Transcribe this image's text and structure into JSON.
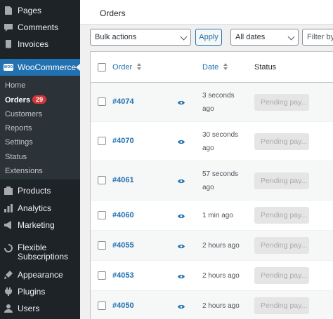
{
  "sidebar": {
    "items_top": [
      {
        "label": "Pages",
        "icon": "pages-icon"
      },
      {
        "label": "Comments",
        "icon": "comments-icon"
      },
      {
        "label": "Invoices",
        "icon": "invoices-icon"
      }
    ],
    "woocommerce": {
      "label": "WooCommerce",
      "icon": "woocommerce-icon"
    },
    "submenu": [
      {
        "label": "Home"
      },
      {
        "label": "Orders",
        "badge": "29"
      },
      {
        "label": "Customers"
      },
      {
        "label": "Reports"
      },
      {
        "label": "Settings"
      },
      {
        "label": "Status"
      },
      {
        "label": "Extensions"
      }
    ],
    "items_bottom": [
      {
        "label": "Products",
        "icon": "products-icon"
      },
      {
        "label": "Analytics",
        "icon": "analytics-icon"
      },
      {
        "label": "Marketing",
        "icon": "marketing-icon"
      },
      {
        "label_line1": "Flexible",
        "label_line2": "Subscriptions",
        "icon": "subscriptions-icon"
      },
      {
        "label": "Appearance",
        "icon": "appearance-icon"
      },
      {
        "label": "Plugins",
        "icon": "plugins-icon"
      },
      {
        "label": "Users",
        "icon": "users-icon"
      }
    ]
  },
  "header": {
    "title": "Orders"
  },
  "filters": {
    "bulk_actions": "Bulk actions",
    "apply": "Apply",
    "dates": "All dates",
    "filter_by": "Filter by"
  },
  "table": {
    "columns": {
      "order": "Order",
      "date": "Date",
      "status": "Status"
    },
    "rows": [
      {
        "order": "#4074",
        "date_line1": "3 seconds",
        "date_line2": "ago",
        "status": "Pending pay..."
      },
      {
        "order": "#4070",
        "date_line1": "30 seconds",
        "date_line2": "ago",
        "status": "Pending pay..."
      },
      {
        "order": "#4061",
        "date_line1": "57 seconds",
        "date_line2": "ago",
        "status": "Pending pay..."
      },
      {
        "order": "#4060",
        "date_line1": "1 min ago",
        "date_line2": "",
        "status": "Pending pay..."
      },
      {
        "order": "#4055",
        "date_line1": "2 hours ago",
        "date_line2": "",
        "status": "Pending pay..."
      },
      {
        "order": "#4053",
        "date_line1": "2 hours ago",
        "date_line2": "",
        "status": "Pending pay..."
      },
      {
        "order": "#4050",
        "date_line1": "2 hours ago",
        "date_line2": "",
        "status": "Pending pay..."
      }
    ]
  },
  "colors": {
    "sidebar_bg": "#1d2327",
    "accent": "#2271b1",
    "badge": "#d63638"
  }
}
